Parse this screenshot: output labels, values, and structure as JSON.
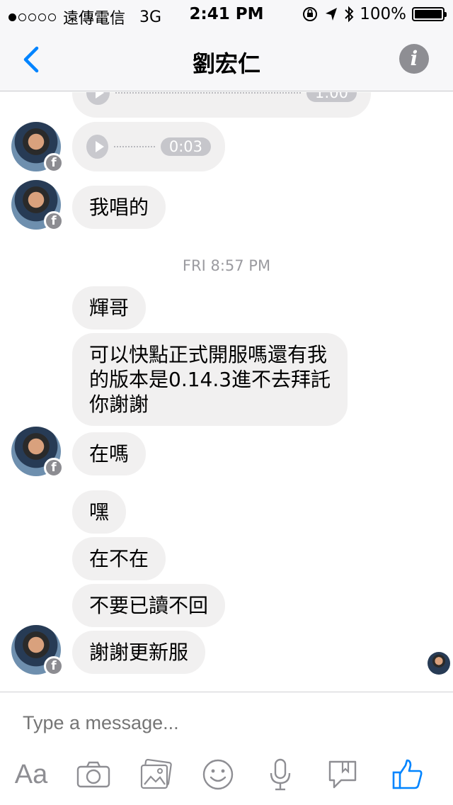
{
  "status_bar": {
    "carrier": "遠傳電信",
    "network": "3G",
    "time": "2:41 PM",
    "battery": "100%",
    "signal_bars_filled": 1,
    "signal_bars_total": 5
  },
  "header": {
    "title": "劉宏仁",
    "back_icon": "chevron-left-icon",
    "info_icon": "info-icon",
    "info_glyph": "i"
  },
  "messages": {
    "audio_1_duration": "1:00",
    "audio_2_duration": "0:03",
    "msg_sang": "我唱的",
    "timestamp": "FRI 8:57 PM",
    "msg_1": "輝哥",
    "msg_2": "可以快點正式開服嗎還有我\n的版本是0.14.3進不去拜託\n你謝謝",
    "msg_3": "在嗎",
    "msg_4": "嘿",
    "msg_5": "在不在",
    "msg_6": "不要已讀不回",
    "msg_7": "謝謝更新服",
    "badge_glyph": "f"
  },
  "composer": {
    "placeholder": "Type a message...",
    "aa_label": "Aa",
    "icons": [
      "camera-icon",
      "gallery-icon",
      "emoji-icon",
      "microphone-icon",
      "sticker-icon",
      "thumbs-up-icon"
    ]
  },
  "colors": {
    "accent": "#0084ff",
    "bubble": "#f1f0f0",
    "icon_gray": "#8e8e93",
    "timestamp": "#9b9ba0"
  }
}
